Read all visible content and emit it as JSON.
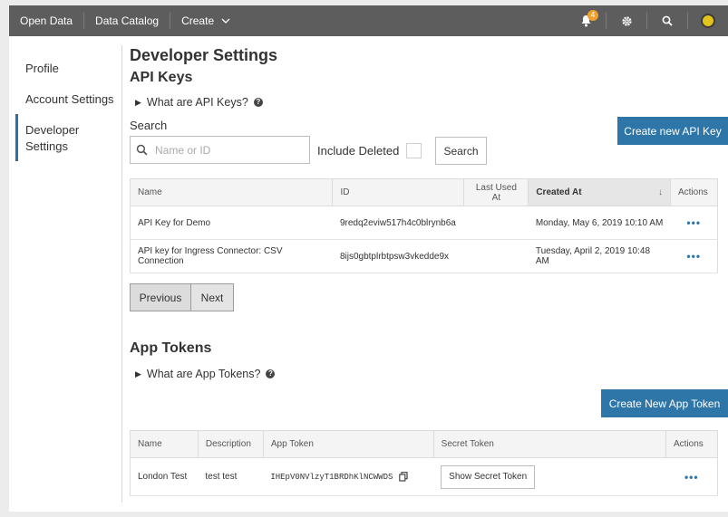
{
  "topbar": {
    "brand": "Open Data",
    "catalog": "Data Catalog",
    "create": "Create",
    "notifications_count": "4"
  },
  "sidebar": {
    "items": [
      {
        "label": "Profile"
      },
      {
        "label": "Account Settings"
      },
      {
        "label": "Developer Settings"
      }
    ]
  },
  "page": {
    "title": "Developer Settings"
  },
  "api_keys": {
    "heading": "API Keys",
    "toggle": "What are API Keys?",
    "search_label": "Search",
    "search_placeholder": "Name or ID",
    "include_deleted": "Include Deleted",
    "search_button": "Search",
    "create_button": "Create new API Key",
    "columns": [
      "Name",
      "ID",
      "Last Used At",
      "Created At",
      "Actions"
    ],
    "rows": [
      {
        "name": "API Key for Demo",
        "id": "9redq2eviw517h4c0blrynb6a",
        "last_used": "",
        "created": "Monday, May 6, 2019 10:10 AM"
      },
      {
        "name": "API key for Ingress Connector: CSV Connection",
        "id": "8ijs0gbtplrbtpsw3vkedde9x",
        "last_used": "",
        "created": "Tuesday, April 2, 2019 10:48 AM"
      }
    ],
    "prev": "Previous",
    "next": "Next"
  },
  "app_tokens": {
    "heading": "App Tokens",
    "toggle": "What are App Tokens?",
    "create_button": "Create New App Token",
    "columns": [
      "Name",
      "Description",
      "App Token",
      "Secret Token",
      "Actions"
    ],
    "rows": [
      {
        "name": "London Test",
        "description": "test test",
        "token": "IHEpV0NVlzyT1BRDhKlNCWWDS",
        "secret_button": "Show Secret Token"
      }
    ]
  },
  "colors": {
    "topbar": "#5d5d5d",
    "primary": "#2f76a8",
    "badge": "#f0a12b"
  }
}
